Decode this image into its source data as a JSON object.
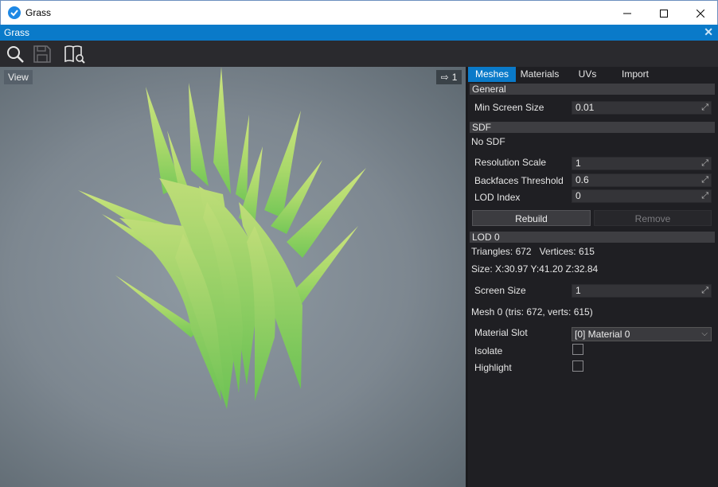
{
  "window": {
    "title": "Grass"
  },
  "document_tab": {
    "label": "Grass"
  },
  "viewport": {
    "view_label": "View",
    "camera_speed": "1"
  },
  "tabs": [
    {
      "label": "Meshes",
      "active": true
    },
    {
      "label": "Materials",
      "active": false
    },
    {
      "label": "UVs",
      "active": false
    },
    {
      "label": "Import",
      "active": false
    }
  ],
  "general": {
    "header": "General",
    "min_screen_size_label": "Min Screen Size",
    "min_screen_size_value": "0.01"
  },
  "sdf": {
    "header": "SDF",
    "status": "No SDF",
    "resolution_scale_label": "Resolution Scale",
    "resolution_scale_value": "1",
    "backfaces_threshold_label": "Backfaces Threshold",
    "backfaces_threshold_value": "0.6",
    "lod_index_label": "LOD Index",
    "lod_index_value": "0",
    "rebuild_label": "Rebuild",
    "remove_label": "Remove"
  },
  "lod0": {
    "header": "LOD 0",
    "stats": "Triangles: 672   Vertices: 615",
    "size": "Size: X:30.97 Y:41.20 Z:32.84",
    "screen_size_label": "Screen Size",
    "screen_size_value": "1",
    "mesh_info": "Mesh 0 (tris: 672, verts: 615)",
    "material_slot_label": "Material Slot",
    "material_slot_value": "[0] Material 0",
    "isolate_label": "Isolate",
    "highlight_label": "Highlight"
  },
  "colors": {
    "accent": "#0a7ac9",
    "grass_light": "#c6e07a",
    "grass_dark": "#7ccc5a"
  }
}
